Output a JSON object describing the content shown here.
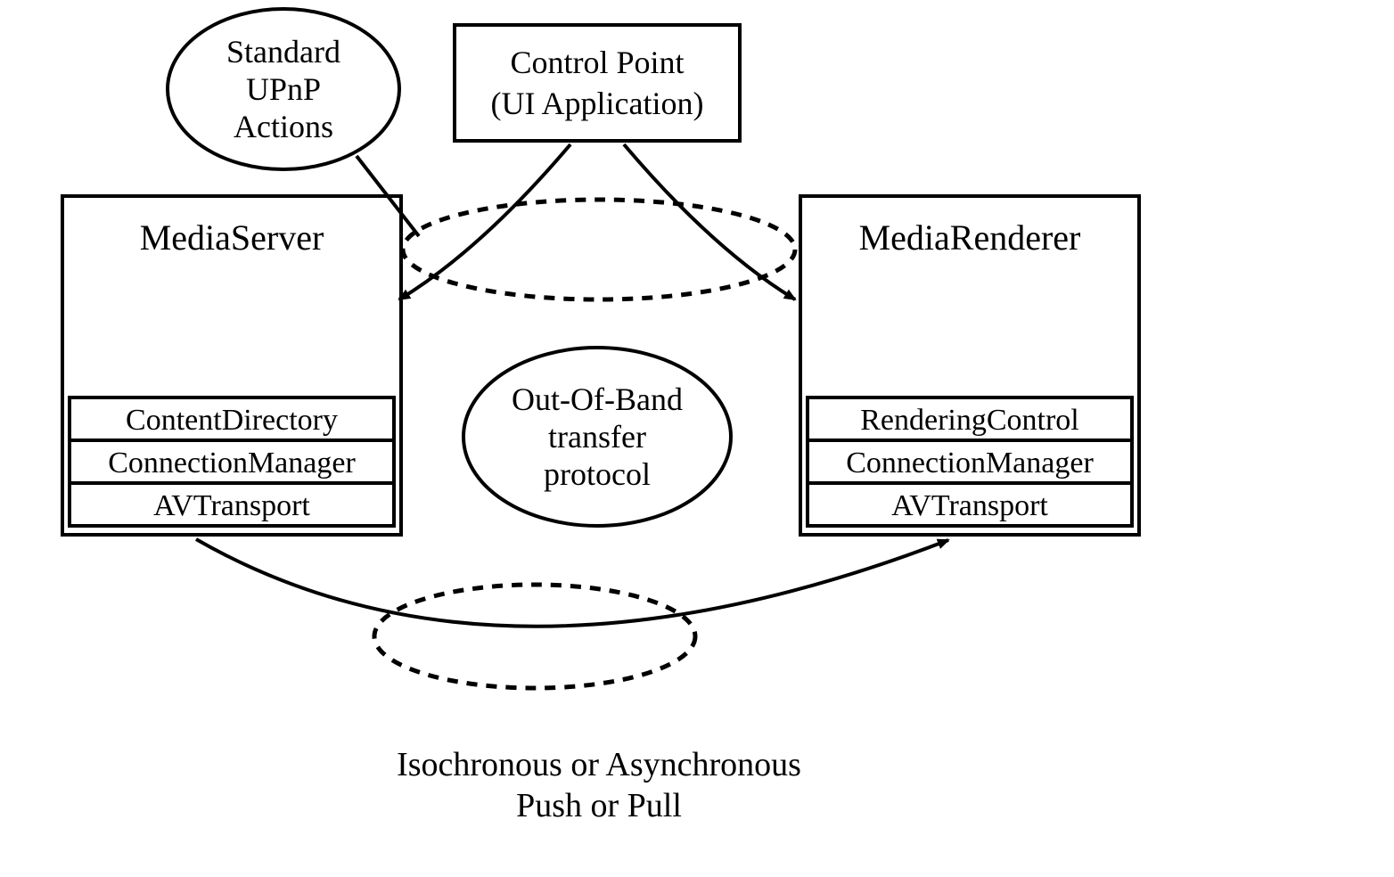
{
  "annotations": {
    "upnp_actions_line1": "Standard",
    "upnp_actions_line2": "UPnP",
    "upnp_actions_line3": "Actions",
    "out_of_band_line1": "Out-Of-Band",
    "out_of_band_line2": "transfer",
    "out_of_band_line3": "protocol",
    "bottom_line1": "Isochronous or Asynchronous",
    "bottom_line2": "Push or Pull"
  },
  "control_point": {
    "line1": "Control Point",
    "line2": "(UI Application)"
  },
  "media_server": {
    "title": "MediaServer",
    "services": {
      "s1": "ContentDirectory",
      "s2": "ConnectionManager",
      "s3": "AVTransport"
    }
  },
  "media_renderer": {
    "title": "MediaRenderer",
    "services": {
      "s1": "RenderingControl",
      "s2": "ConnectionManager",
      "s3": "AVTransport"
    }
  }
}
